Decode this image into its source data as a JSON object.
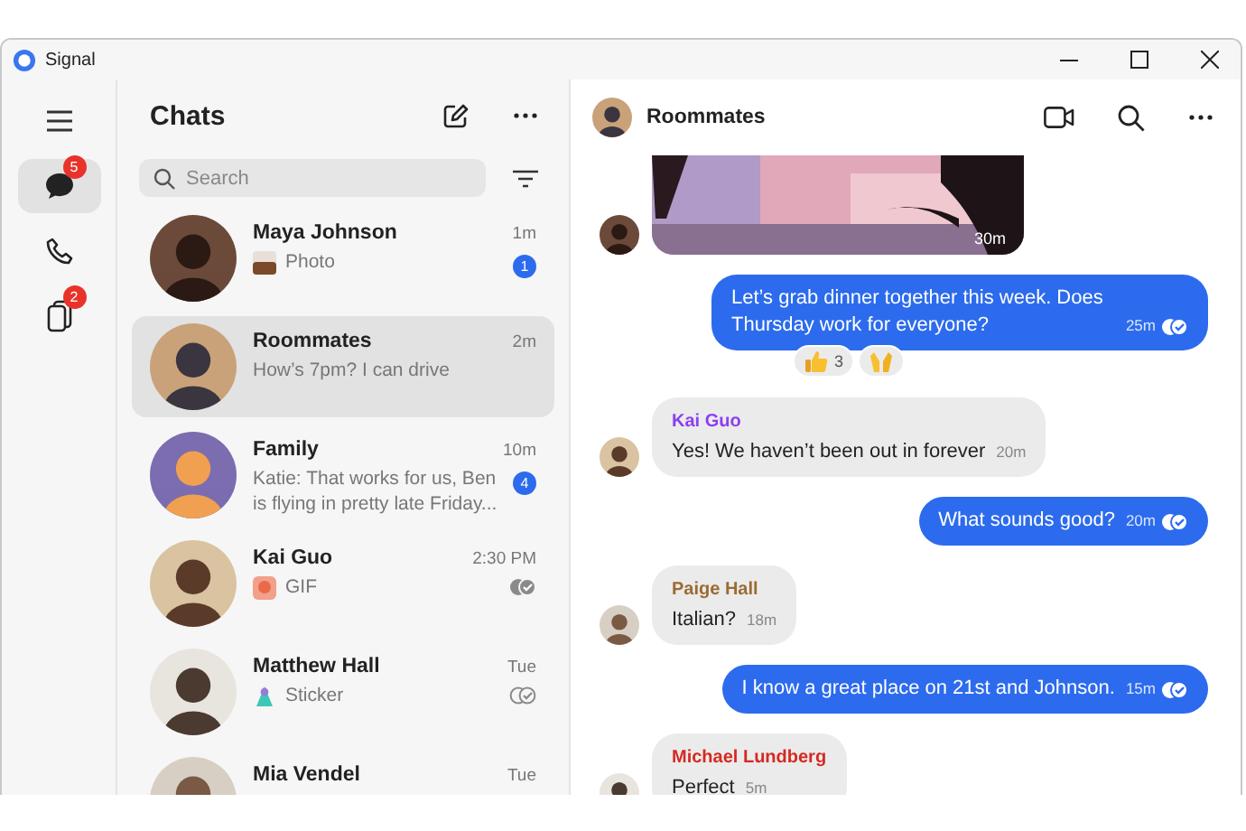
{
  "window": {
    "title": "Signal"
  },
  "nav": {
    "items": [
      {
        "kind": "chats",
        "badge": "5",
        "selected": true
      },
      {
        "kind": "calls",
        "selected": false
      },
      {
        "kind": "stories",
        "badge": "2",
        "selected": false
      }
    ]
  },
  "chat_list": {
    "title": "Chats",
    "search": {
      "placeholder": "Search"
    },
    "chats": [
      {
        "name": "Maya Johnson",
        "preview": "Photo",
        "time": "1m",
        "unread": "1",
        "selected": false
      },
      {
        "name": "Roommates",
        "preview": "How’s 7pm? I can drive",
        "time": "2m",
        "selected": true
      },
      {
        "name": "Family",
        "preview": "Katie: That works for us, Ben is flying in pretty late Friday...",
        "time": "10m",
        "unread": "4",
        "selected": false
      },
      {
        "name": "Kai Guo",
        "preview": "GIF",
        "attachment": {
          "kind": "gif"
        },
        "time": "2:30 PM",
        "receipt": {
          "kind": "read"
        },
        "selected": false
      },
      {
        "name": "Matthew Hall",
        "preview": "Sticker",
        "attachment": {
          "kind": "sticker"
        },
        "time": "Tue",
        "receipt": {
          "kind": "delivered"
        },
        "selected": false
      },
      {
        "name": "Mia Vendel",
        "time": "Tue",
        "selected": false
      }
    ]
  },
  "conversation": {
    "title": "Roommates",
    "messages": [
      {
        "time": "30m"
      },
      {
        "kind": "outgoing",
        "text": "Let’s grab dinner together this week. Does Thursday work for everyone?",
        "time": "25m",
        "receipt": {
          "kind": "read"
        },
        "reactions": [
          {
            "kind": "thumbs-up",
            "count": "3"
          },
          {
            "kind": "raised-hands"
          }
        ]
      },
      {
        "kind": "incoming",
        "sender": "Kai Guo",
        "color": "#8b3ff0",
        "text": "Yes! We haven’t been out in forever",
        "time": "20m"
      },
      {
        "kind": "outgoing",
        "text": "What sounds good?",
        "time": "20m",
        "receipt": {
          "kind": "read"
        }
      },
      {
        "kind": "incoming",
        "sender": "Paige Hall",
        "color": "#9a6b32",
        "text": "Italian?",
        "time": "18m"
      },
      {
        "kind": "outgoing",
        "text": "I know a great place on 21st and Johnson.",
        "time": "15m",
        "receipt": {
          "kind": "read"
        }
      },
      {
        "kind": "incoming",
        "sender": "Michael Lundberg",
        "color": "#d42a22",
        "text": "Perfect",
        "time": "5m"
      }
    ]
  }
}
